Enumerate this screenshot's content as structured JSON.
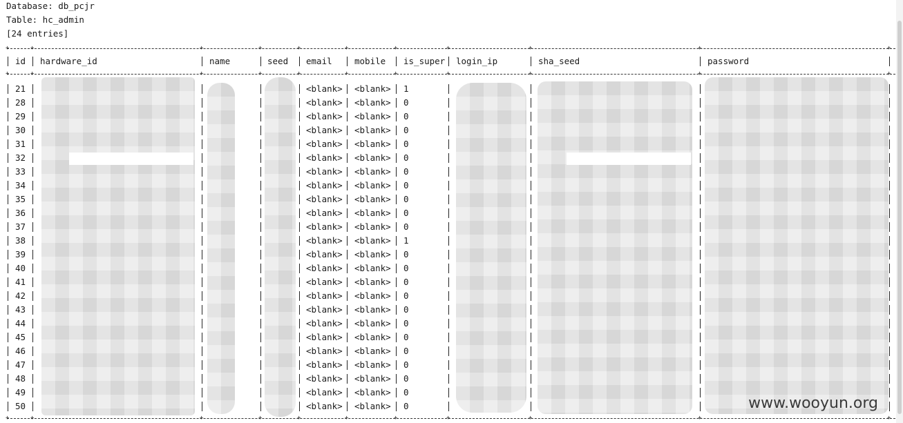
{
  "meta": {
    "database": "Database: db_pcjr",
    "table": "Table: hc_admin",
    "count": "[24 entries]"
  },
  "columns": [
    "id",
    "hardware_id",
    "name",
    "seed",
    "email",
    "mobile",
    "is_super",
    "login_ip",
    "sha_seed",
    "password"
  ],
  "rows": [
    {
      "id": "21",
      "email": "<blank>",
      "mobile": "<blank>",
      "is_super": "1"
    },
    {
      "id": "28",
      "email": "<blank>",
      "mobile": "<blank>",
      "is_super": "0"
    },
    {
      "id": "29",
      "email": "<blank>",
      "mobile": "<blank>",
      "is_super": "0"
    },
    {
      "id": "30",
      "email": "<blank>",
      "mobile": "<blank>",
      "is_super": "0"
    },
    {
      "id": "31",
      "email": "<blank>",
      "mobile": "<blank>",
      "is_super": "0"
    },
    {
      "id": "32",
      "email": "<blank>",
      "mobile": "<blank>",
      "is_super": "0"
    },
    {
      "id": "33",
      "email": "<blank>",
      "mobile": "<blank>",
      "is_super": "0"
    },
    {
      "id": "34",
      "email": "<blank>",
      "mobile": "<blank>",
      "is_super": "0"
    },
    {
      "id": "35",
      "email": "<blank>",
      "mobile": "<blank>",
      "is_super": "0"
    },
    {
      "id": "36",
      "email": "<blank>",
      "mobile": "<blank>",
      "is_super": "0"
    },
    {
      "id": "37",
      "email": "<blank>",
      "mobile": "<blank>",
      "is_super": "0"
    },
    {
      "id": "38",
      "email": "<blank>",
      "mobile": "<blank>",
      "is_super": "1"
    },
    {
      "id": "39",
      "email": "<blank>",
      "mobile": "<blank>",
      "is_super": "0"
    },
    {
      "id": "40",
      "email": "<blank>",
      "mobile": "<blank>",
      "is_super": "0"
    },
    {
      "id": "41",
      "email": "<blank>",
      "mobile": "<blank>",
      "is_super": "0"
    },
    {
      "id": "42",
      "email": "<blank>",
      "mobile": "<blank>",
      "is_super": "0"
    },
    {
      "id": "43",
      "email": "<blank>",
      "mobile": "<blank>",
      "is_super": "0"
    },
    {
      "id": "44",
      "email": "<blank>",
      "mobile": "<blank>",
      "is_super": "0"
    },
    {
      "id": "45",
      "email": "<blank>",
      "mobile": "<blank>",
      "is_super": "0"
    },
    {
      "id": "46",
      "email": "<blank>",
      "mobile": "<blank>",
      "is_super": "0"
    },
    {
      "id": "47",
      "email": "<blank>",
      "mobile": "<blank>",
      "is_super": "0"
    },
    {
      "id": "48",
      "email": "<blank>",
      "mobile": "<blank>",
      "is_super": "0"
    },
    {
      "id": "49",
      "email": "<blank>",
      "mobile": "<blank>",
      "is_super": "0"
    },
    {
      "id": "50",
      "email": "<blank>",
      "mobile": "<blank>",
      "is_super": "0"
    }
  ],
  "watermark": "www.wooyun.org",
  "colors": {
    "background": "#ffffff",
    "text": "#1a1a1a",
    "redaction": "#e2e2e2"
  }
}
